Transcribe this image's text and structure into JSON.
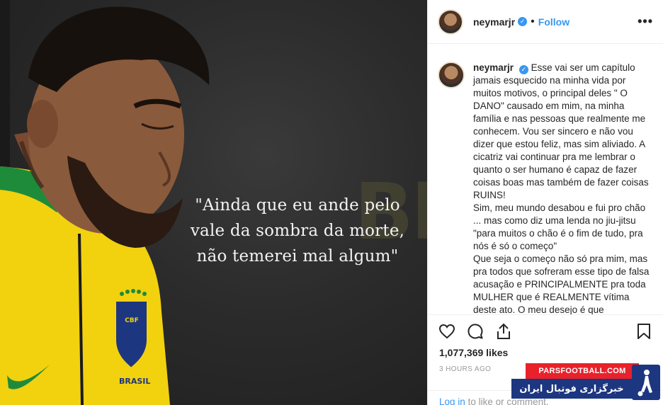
{
  "photo": {
    "quote": "\"Ainda que eu ande pelo\nvale da sombra da morte,\nnão temerei mal algum\"",
    "background_text": "BR",
    "jersey_text": "BRASIL",
    "crest_text": "CBF"
  },
  "header": {
    "username": "neymarjr",
    "separator": "•",
    "follow_label": "Follow",
    "more_label": "•••"
  },
  "caption": {
    "username": "neymarjr",
    "text": "Esse vai ser um capítulo jamais esquecido na minha vida por muitos motivos, o principal deles \" O DANO\" causado em mim, na minha família e nas pessoas que realmente me conhecem. Vou ser sincero e não vou dizer que estou feliz, mas sim aliviado. A cicatriz vai continuar pra me lembrar o quanto o ser humano é capaz de fazer coisas boas mas também de fazer coisas RUINS!\nSim, meu mundo desabou e fui pro chão ... mas como diz uma lenda no jiu-jitsu \"para muitos o chão é o fim de tudo, pra nós é só o começo\"\nQue seja o começo não só pra mim, mas pra todos que sofreram esse tipo de falsa acusação e PRINCIPALMENTE pra toda MULHER que é REALMENTE vítima deste ato. O meu desejo é que"
  },
  "post": {
    "likes": "1,077,369 likes",
    "time": "3 HOURS AGO"
  },
  "login": {
    "link_text": "Log in",
    "suffix": "to like or comment."
  },
  "watermark": {
    "site": "PARSFOOTBALL.COM",
    "tagline": "خبرگزاری فوتبال ایران"
  },
  "colors": {
    "accent": "#3897f0",
    "jersey_yellow": "#f2d10f",
    "jersey_green": "#1e8b3a",
    "watermark_red": "#e8212b",
    "watermark_blue": "#1d3680"
  }
}
